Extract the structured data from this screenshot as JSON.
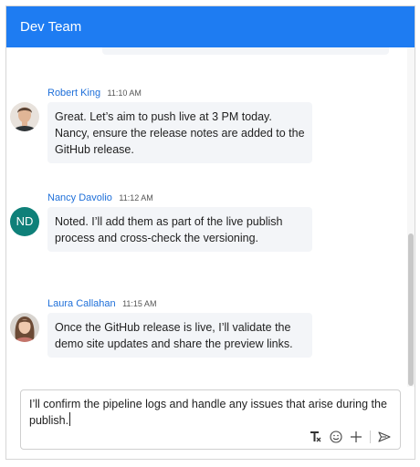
{
  "chat": {
    "title": "Dev Team",
    "messages": [
      {
        "author": "Robert King",
        "time": "11:10 AM",
        "text": "Great. Let’s aim to push live at 3 PM today. Nancy, ensure the release notes are added to the GitHub release.",
        "avatar": "photo"
      },
      {
        "author": "Nancy Davolio",
        "time": "11:12 AM",
        "text": "Noted. I’ll add them as part of the live publish process and cross-check the versioning.",
        "avatar": "ND",
        "avatar_color": "#0f8079"
      },
      {
        "author": "Laura Callahan",
        "time": "11:15 AM",
        "text": "Once the GitHub release is live, I’ll validate the demo site updates and share the preview links.",
        "avatar": "photo"
      }
    ]
  },
  "composer": {
    "value": "I’ll confirm the pipeline logs and handle any issues that arise during the publish.",
    "tools": [
      "clear-format-icon",
      "emoji-icon",
      "attach-plus-icon",
      "send-icon"
    ]
  },
  "colors": {
    "header": "#1e7cf2",
    "author_link": "#1e6fd9",
    "bubble": "#f3f5f8"
  }
}
